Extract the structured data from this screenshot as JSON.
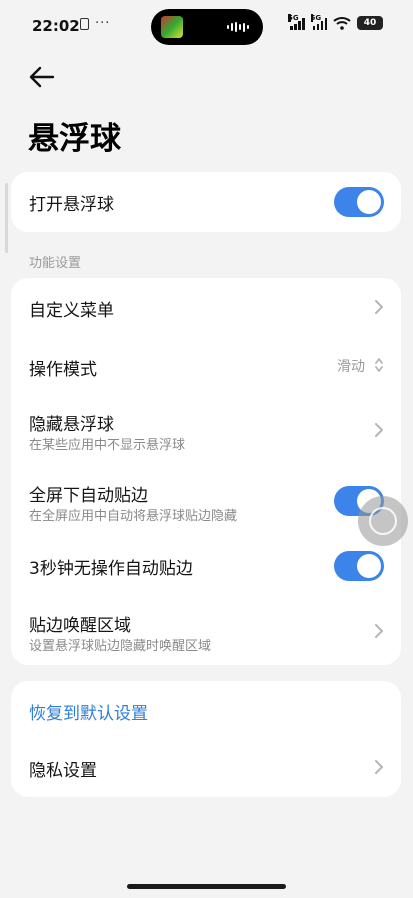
{
  "status_bar": {
    "time": "22:02",
    "more": "···",
    "signal1_label": "5G",
    "signal2_label": "5G",
    "battery": "40"
  },
  "header": {
    "title": "悬浮球"
  },
  "main_toggle": {
    "label": "打开悬浮球",
    "on": true
  },
  "section": {
    "label": "功能设置"
  },
  "settings": {
    "custom_menu": {
      "title": "自定义菜单"
    },
    "operation_mode": {
      "title": "操作模式",
      "value": "滑动"
    },
    "hide_ball": {
      "title": "隐藏悬浮球",
      "subtitle": "在某些应用中不显示悬浮球"
    },
    "fullscreen_edge": {
      "title": "全屏下自动贴边",
      "subtitle": "在全屏应用中自动将悬浮球贴边隐藏",
      "on": true
    },
    "idle_edge": {
      "title": "3秒钟无操作自动贴边",
      "on": true
    },
    "wake_area": {
      "title": "贴边唤醒区域",
      "subtitle": "设置悬浮球贴边隐藏时唤醒区域"
    }
  },
  "footer_card": {
    "restore": "恢复到默认设置",
    "privacy": "隐私设置"
  },
  "colors": {
    "accent": "#3c84e9",
    "link": "#2f7fd8",
    "background": "#f3f3f3"
  }
}
